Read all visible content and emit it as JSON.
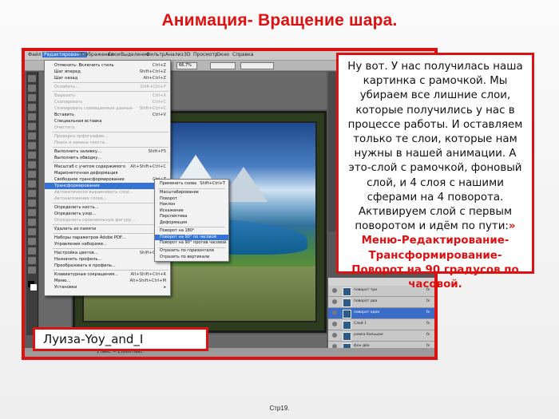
{
  "slide": {
    "title": "Анимация- Вращение шара.",
    "footer": "Стр19.",
    "author": "Луиза-Yoy_and_I"
  },
  "callout": {
    "text": "Ну вот. У нас получилась наша картинка с рамочкой. Мы убираем все лишние слои, которые получились у нас в процессе работы. И оставляем только те слои, которые нам нужны в нашей анимации. А это-слой с рамочкой, фоновый слой, и 4 слоя с нашими сферами на 4 поворота. Активируем слой с первым поворотом и идём по пути:",
    "path_prefix": "» ",
    "path": "Меню-Редактирование-Трансформирование-Поворот на 90 градусов по часовой."
  },
  "app": {
    "menu": [
      "Файл",
      "Редактирование",
      "Изображение",
      "Слои",
      "Выделение",
      "Фильтр",
      "Анализ",
      "3D",
      "Просмотр",
      "Окно",
      "Справка"
    ],
    "zoom": "66,7%",
    "status": "1 пикс. = 1,0000 пикс.",
    "edit_menu": [
      {
        "label": "Отменить: Включить стиль",
        "shortcut": "Ctrl+Z"
      },
      {
        "label": "Шаг вперед",
        "shortcut": "Shift+Ctrl+Z"
      },
      {
        "label": "Шаг назад",
        "shortcut": "Alt+Ctrl+Z"
      },
      {
        "label": "Ослабить...",
        "shortcut": "Shift+Ctrl+F",
        "disabled": true
      },
      {
        "label": "Вырезать",
        "shortcut": "Ctrl+X",
        "disabled": true
      },
      {
        "label": "Скопировать",
        "shortcut": "Ctrl+C",
        "disabled": true
      },
      {
        "label": "Скопировать совмещенные данные",
        "shortcut": "Shift+Ctrl+C",
        "disabled": true
      },
      {
        "label": "Вставить",
        "shortcut": "Ctrl+V"
      },
      {
        "label": "Специальная вставка",
        "shortcut": ""
      },
      {
        "label": "Очистить",
        "shortcut": "",
        "disabled": true
      },
      {
        "label": "Проверка орфографии...",
        "shortcut": "",
        "disabled": true
      },
      {
        "label": "Поиск и замена текста...",
        "shortcut": "",
        "disabled": true
      },
      {
        "label": "Выполнить заливку...",
        "shortcut": "Shift+F5"
      },
      {
        "label": "Выполнить обводку...",
        "shortcut": ""
      },
      {
        "label": "Масштаб с учетом содержимого",
        "shortcut": "Alt+Shift+Ctrl+C"
      },
      {
        "label": "Марионеточная деформация",
        "shortcut": ""
      },
      {
        "label": "Свободное трансформирование",
        "shortcut": "Ctrl+T"
      },
      {
        "label": "Трансформирование",
        "shortcut": "",
        "highlight": true
      },
      {
        "label": "Автоматически выравнивать слои...",
        "shortcut": "",
        "disabled": true
      },
      {
        "label": "Автоналожение слоев...",
        "shortcut": "",
        "disabled": true
      },
      {
        "label": "Определить кисть...",
        "shortcut": ""
      },
      {
        "label": "Определить узор...",
        "shortcut": ""
      },
      {
        "label": "Определить произвольную фигуру...",
        "shortcut": "",
        "disabled": true
      },
      {
        "label": "Удалить из памяти",
        "shortcut": ""
      },
      {
        "label": "Наборы параметров Adobe PDF...",
        "shortcut": ""
      },
      {
        "label": "Управление наборами...",
        "shortcut": ""
      },
      {
        "label": "Настройка цветов...",
        "shortcut": "Shift+Ctrl+K"
      },
      {
        "label": "Назначить профиль...",
        "shortcut": ""
      },
      {
        "label": "Преобразовать в профиль...",
        "shortcut": ""
      },
      {
        "label": "Клавиатурные сокращения...",
        "shortcut": "Alt+Shift+Ctrl+K"
      },
      {
        "label": "Меню...",
        "shortcut": "Alt+Shift+Ctrl+M"
      },
      {
        "label": "Установки",
        "shortcut": ""
      }
    ],
    "transform_submenu": [
      {
        "label": "Применить снова",
        "shortcut": "Shift+Ctrl+T"
      },
      {
        "label": "Масштабирование",
        "shortcut": ""
      },
      {
        "label": "Поворот",
        "shortcut": ""
      },
      {
        "label": "Наклон",
        "shortcut": ""
      },
      {
        "label": "Искажение",
        "shortcut": ""
      },
      {
        "label": "Перспектива",
        "shortcut": ""
      },
      {
        "label": "Деформация",
        "shortcut": ""
      },
      {
        "label": "Поворот на 180°",
        "shortcut": ""
      },
      {
        "label": "Поворот на 90° по часовой",
        "shortcut": "",
        "highlight": true
      },
      {
        "label": "Поворот на 90° против часовой",
        "shortcut": ""
      },
      {
        "label": "Отразить по горизонтали",
        "shortcut": ""
      },
      {
        "label": "Отразить по вертикали",
        "shortcut": ""
      }
    ],
    "layers": [
      {
        "name": "поворот три",
        "fx": "fx"
      },
      {
        "name": "поворот два",
        "fx": "fx"
      },
      {
        "name": "поворот один",
        "fx": "fx",
        "selected": true
      },
      {
        "name": "Слой 1",
        "fx": "fx"
      },
      {
        "name": "рамка большая",
        "fx": "fx"
      },
      {
        "name": "фон два",
        "fx": "fx"
      }
    ]
  }
}
